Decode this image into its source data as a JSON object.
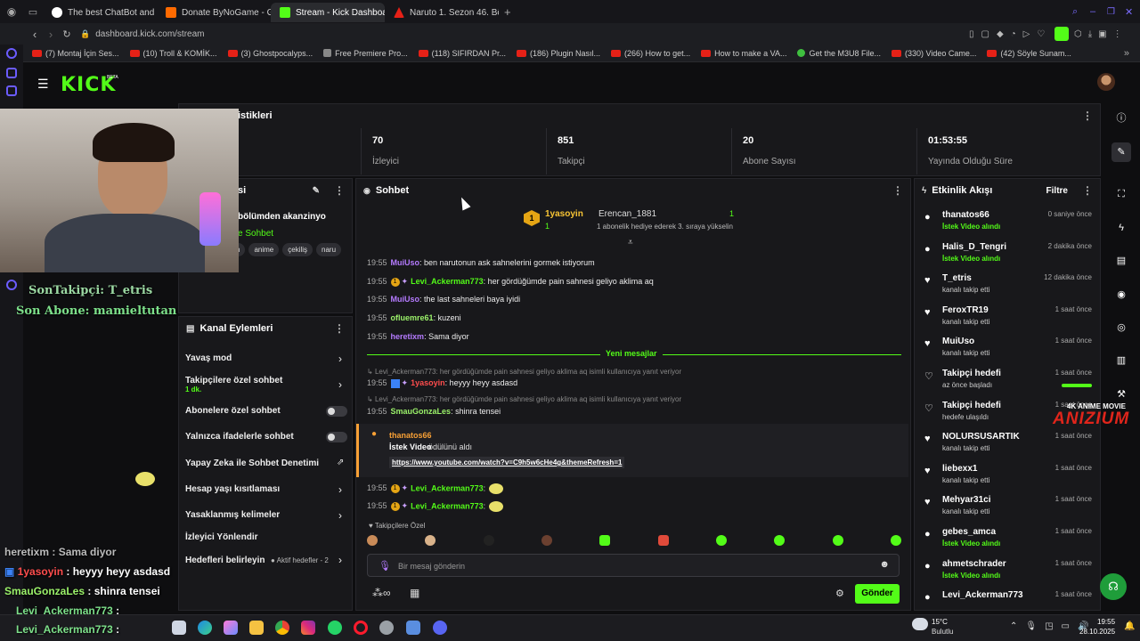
{
  "tabs": [
    {
      "label": "The best ChatBot and W...",
      "active": false,
      "color": "#ffffff"
    },
    {
      "label": "Donate ByNoGame - Gel...",
      "active": false,
      "color": "#ff6a00"
    },
    {
      "label": "Stream - Kick Dashboard",
      "active": true,
      "color": "#53fc18"
    },
    {
      "label": "Naruto 1. Sezon 46. Bölüm",
      "active": false,
      "color": "#e62117"
    }
  ],
  "url": "dashboard.kick.com/stream",
  "bookmarks": [
    "(7) Montaj İçin Ses...",
    "(10) Troll & KOMİK...",
    "(3) Ghostpocalyps...",
    "Free Premiere Pro...",
    "(118) SIFIRDAN Pr...",
    "(186) Plugin Nasıl...",
    "(266) How to get...",
    "How to make a VA...",
    "Get the M3U8 File...",
    "(330) Video Came...",
    "(42) Söyle Sunam..."
  ],
  "logo": "KICK",
  "logo_tag": "BETA",
  "stats": {
    "title": "istikleri",
    "items": [
      {
        "value": "70",
        "label": "İzleyici"
      },
      {
        "value": "851",
        "label": "Takipçi"
      },
      {
        "value": "20",
        "label": "Abone Sayısı"
      },
      {
        "value": "01:53:55",
        "label": "Yayında Olduğu Süre"
      }
    ]
  },
  "stream_info": {
    "title_fragment": "si",
    "line": "bölümden akanzinyo",
    "category": "e Sohbet",
    "tags": [
      "h",
      "anime",
      "çekiliş",
      "naru"
    ]
  },
  "chat": {
    "title": "Sohbet",
    "gift_top": {
      "user": "1yasoyin",
      "recipient": "Erencan_1881",
      "count": "1",
      "message": "1 abonelik hediye ederek 3. sıraya yükselin"
    },
    "messages": [
      {
        "time": "19:55",
        "user": "MuiUso",
        "text": ": ben narutonun ask sahnelerini gormek istiyorum",
        "cls": "u-purple"
      },
      {
        "time": "19:55",
        "user": "Levi_Ackerman773",
        "text": ": her gördüğümde pain sahnesi geliyo aklima aq",
        "cls": "u-green"
      },
      {
        "time": "19:55",
        "user": "MuiUso",
        "text": ": the last sahneleri baya iyidi",
        "cls": "u-purple"
      },
      {
        "time": "19:55",
        "user": "ofluemre61",
        "text": ": kuzeni",
        "cls": "u-lime"
      },
      {
        "time": "19:55",
        "user": "heretixm",
        "text": ": Sama diyor",
        "cls": "u-purple"
      }
    ],
    "new_messages_label": "Yeni mesajlar",
    "reply1": "Levi_Ackerman773: her gördüğümde pain sahnesi geliyo aklima aq isimli kullanıcıya yanıt veriyor",
    "reply1_msg": {
      "time": "19:55",
      "user": "1yasoyin",
      "text": ": heyyy heyy asdasd"
    },
    "reply2": "Levi_Ackerman773: her gördüğümde pain sahnesi geliyo aklima aq isimli kullanıcıya yanıt veriyor",
    "reply2_msg": {
      "time": "19:55",
      "user": "SmauGonzaLes",
      "text": ": shinra tensei"
    },
    "reward": {
      "user": "thanatos66",
      "reward": "İstek Video",
      "suffix": " ödülünü aldı",
      "link": "https://www.youtube.com/watch?v=C9h5w6cHe4g&themeRefresh=1"
    },
    "emote_msgs": [
      {
        "time": "19:55",
        "user": "Levi_Ackerman773",
        "text": ":"
      },
      {
        "time": "19:55",
        "user": "Levi_Ackerman773",
        "text": ":"
      }
    ],
    "followers_only": "Takipçilere Özel",
    "input_placeholder": "Bir mesaj gönderin",
    "send_label": "Gönder"
  },
  "actions": {
    "title": "Kanal Eylemleri",
    "items": [
      {
        "label": "Yavaş mod",
        "sub": "",
        "control": "chevron"
      },
      {
        "label": "Takipçilere özel sohbet",
        "sub": "1 dk.",
        "control": "chevron"
      },
      {
        "label": "Abonelere özel sohbet",
        "sub": "",
        "control": "toggle"
      },
      {
        "label": "Yalnızca ifadelerle sohbet",
        "sub": "",
        "control": "toggle"
      },
      {
        "label": "Yapay Zeka ile Sohbet Denetimi",
        "sub": "",
        "control": "external"
      },
      {
        "label": "Hesap yaşı kısıtlaması",
        "sub": "",
        "control": "chevron"
      },
      {
        "label": "Yasaklanmış kelimeler",
        "sub": "",
        "control": "chevron"
      },
      {
        "label": "İzleyici Yönlendir",
        "sub": "",
        "control": "none"
      },
      {
        "label": "Hedefleri belirleyin",
        "sub": "",
        "control": "chevron"
      }
    ],
    "goals_status": "Aktif hedefler - 2"
  },
  "activity": {
    "title": "Etkinlik Akışı",
    "filter": "Filtre",
    "events": [
      {
        "name": "thanatos66",
        "sub": "İstek Video alındı",
        "time": "0 saniye önce",
        "type": "reward"
      },
      {
        "name": "Halis_D_Tengri",
        "sub": "İstek Video alındı",
        "time": "2 dakika önce",
        "type": "reward"
      },
      {
        "name": "T_etris",
        "sub": "kanalı takip etti",
        "time": "12 dakika önce",
        "type": "follow"
      },
      {
        "name": "FeroxTR19",
        "sub": "kanalı takip etti",
        "time": "1 saat önce",
        "type": "follow"
      },
      {
        "name": "MuiUso",
        "sub": "kanalı takip etti",
        "time": "1 saat önce",
        "type": "follow"
      },
      {
        "name": "Takipçi hedefi",
        "sub": "az önce başladı",
        "time": "1 saat önce",
        "type": "goal"
      },
      {
        "name": "Takipçi hedefi",
        "sub": "hedefe ulaşıldı",
        "time": "1 saat önce",
        "type": "goal"
      },
      {
        "name": "NOLURSUSARTIK",
        "sub": "kanalı takip etti",
        "time": "1 saat önce",
        "type": "follow"
      },
      {
        "name": "liebexx1",
        "sub": "kanalı takip etti",
        "time": "1 saat önce",
        "type": "follow"
      },
      {
        "name": "Mehyar31ci",
        "sub": "kanalı takip etti",
        "time": "1 saat önce",
        "type": "follow"
      },
      {
        "name": "gebes_amca",
        "sub": "İstek Video alındı",
        "time": "1 saat önce",
        "type": "reward"
      },
      {
        "name": "ahmetschrader",
        "sub": "İstek Video alındı",
        "time": "1 saat önce",
        "type": "reward"
      },
      {
        "name": "Levi_Ackerman773",
        "sub": "",
        "time": "1 saat önce",
        "type": "reward"
      }
    ]
  },
  "overlay": {
    "last_follower": "SonTakipçi: T_etris",
    "last_sub": "Son Abone: mamieltutan",
    "chat": [
      {
        "user": "heretixm",
        "text": " : Sama diyor"
      },
      {
        "user": "1yasoyin",
        "text": " : heyyy heyy asdasd"
      },
      {
        "user": "SmauGonzaLes",
        "text": " : shinra tensei"
      },
      {
        "user": "Levi_Ackerman773",
        "text": " :"
      },
      {
        "user": "Levi_Ackerman773",
        "text": " :"
      }
    ],
    "watermark_top": "4K ANIME MOVIE",
    "watermark_brand": "ANIZIUM"
  },
  "taskbar": {
    "weather_temp": "15°C",
    "weather_desc": "Bulutlu",
    "time": "19:55",
    "date": "28.10.2025"
  },
  "colors": {
    "brand": "#53fc18",
    "bg": "#0e0e10",
    "panel": "#18181b"
  }
}
